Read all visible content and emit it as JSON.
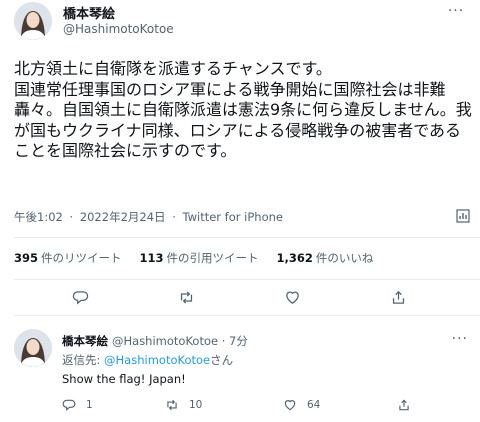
{
  "tweet": {
    "author_name": "橋本琴絵",
    "handle": "@HashimotoKotoe",
    "text": "北方領土に自衛隊を派遣するチャンスです。\n国連常任理事国のロシア軍による戦争開始に国際社会は非難轟々。自国領土に自衛隊派遣は憲法9条に何ら違反しません。我が国もウクライナ同様、ロシアによる侵略戦争の被害者であることを国際社会に示すのです。",
    "time": "午後1:02",
    "date": "2022年2月24日",
    "separator": "·",
    "source": "Twitter for iPhone"
  },
  "stats": {
    "retweets_count": "395",
    "retweets_label": "件のリツイート",
    "quotes_count": "113",
    "quotes_label": "件の引用ツイート",
    "likes_count": "1,362",
    "likes_label": "件のいいね"
  },
  "actions": {
    "icons": [
      "reply-icon",
      "retweet-icon",
      "like-icon",
      "share-icon"
    ]
  },
  "reply": {
    "author_name": "橋本琴絵",
    "handle_time": "@HashimotoKotoe · 7分",
    "reply_to_prefix": "返信先: ",
    "reply_to_mention": "@HashimotoKotoe",
    "reply_to_suffix": "さん",
    "text": "Show the flag! Japan!",
    "reply_count": "1",
    "retweet_count": "10",
    "like_count": "64"
  },
  "colors": {
    "text": "#0f1419",
    "secondary": "#536471",
    "link": "#1d9bf0",
    "divider": "#e6ecf0"
  }
}
